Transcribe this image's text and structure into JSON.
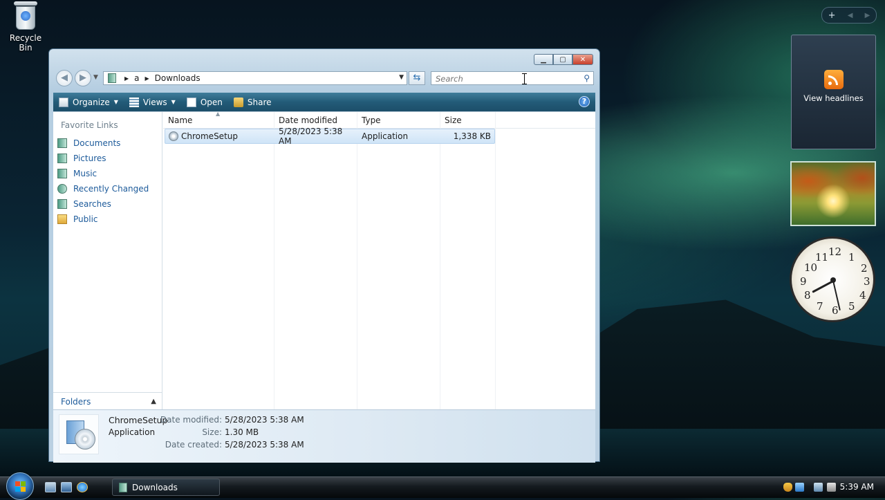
{
  "desktop": {
    "recycle_bin_label": "Recycle Bin"
  },
  "gadgets": {
    "feed_label": "View headlines",
    "clock_numbers": [
      "12",
      "1",
      "2",
      "3",
      "4",
      "5",
      "6",
      "7",
      "8",
      "9",
      "10",
      "11"
    ]
  },
  "window": {
    "address": {
      "segments": [
        "a",
        "Downloads"
      ]
    },
    "search": {
      "placeholder": "Search"
    },
    "toolbar": {
      "organize": "Organize",
      "views": "Views",
      "open": "Open",
      "share": "Share",
      "help": "?"
    },
    "nav_pane": {
      "title": "Favorite Links",
      "items": [
        "Documents",
        "Pictures",
        "Music",
        "Recently Changed",
        "Searches",
        "Public"
      ],
      "folders_label": "Folders"
    },
    "columns": [
      "Name",
      "Date modified",
      "Type",
      "Size"
    ],
    "files": [
      {
        "name": "ChromeSetup",
        "date_modified": "5/28/2023 5:38 AM",
        "type": "Application",
        "size": "1,338 KB"
      }
    ],
    "details": {
      "name": "ChromeSetup",
      "type": "Application",
      "date_modified_label": "Date modified:",
      "date_modified": "5/28/2023 5:38 AM",
      "size_label": "Size:",
      "size": "1.30 MB",
      "date_created_label": "Date created:",
      "date_created": "5/28/2023 5:38 AM"
    }
  },
  "taskbar": {
    "task_label": "Downloads",
    "time": "5:39 AM"
  }
}
